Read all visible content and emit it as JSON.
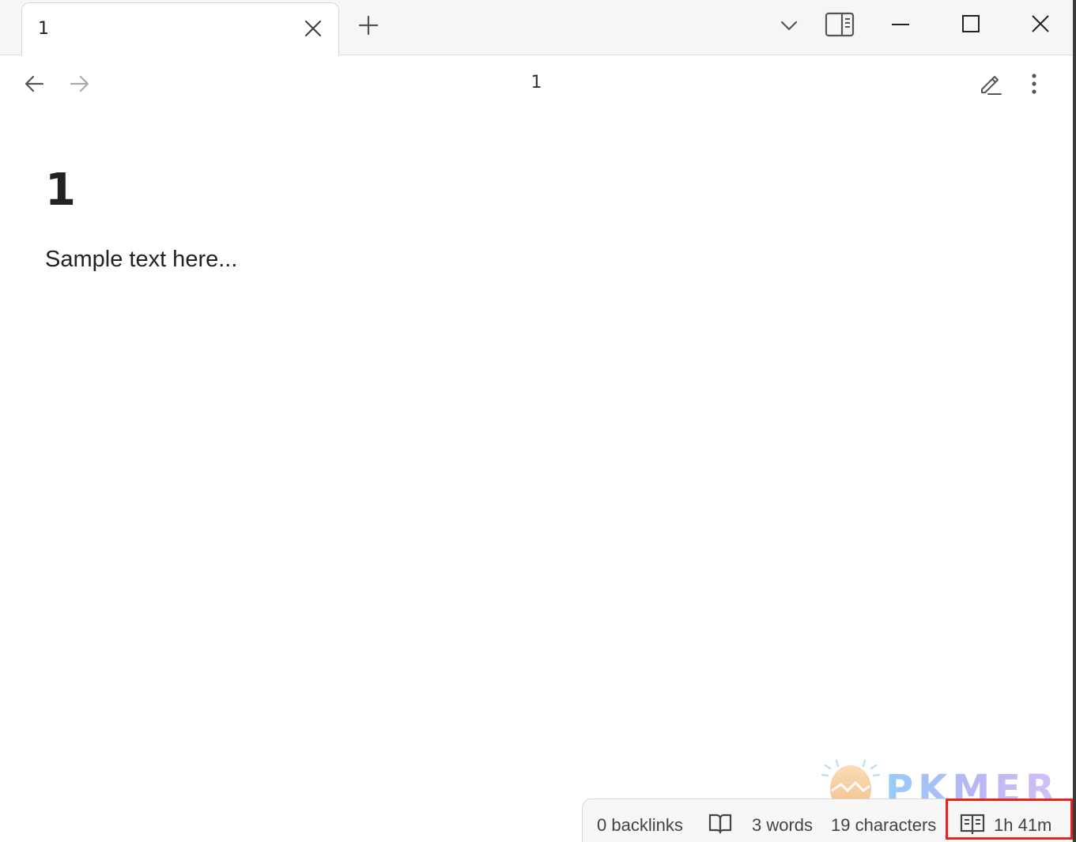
{
  "tab": {
    "title": "1"
  },
  "header": {
    "view_title": "1"
  },
  "note": {
    "heading": "1",
    "body": "Sample text here..."
  },
  "watermark": {
    "text": "PKMER"
  },
  "statusbar": {
    "backlinks": "0 backlinks",
    "words": "3 words",
    "characters": "19 characters",
    "reading_time": "1h 41m"
  },
  "icons": {
    "tab_close": "close-icon",
    "new_tab": "plus-icon",
    "tab_list": "chevron-down-icon",
    "sidebar": "sidebar-toggle-icon",
    "minimize": "minimize-icon",
    "maximize": "maximize-icon",
    "close": "close-icon",
    "back": "arrow-left-icon",
    "forward": "arrow-right-icon",
    "edit": "pencil-icon",
    "more": "more-vertical-icon",
    "reader": "book-open-icon"
  },
  "colors": {
    "highlight": "#e8231f",
    "watermark_start": "#3fa4f5",
    "watermark_end": "#b48cf0",
    "egg": "#f3a24b"
  }
}
